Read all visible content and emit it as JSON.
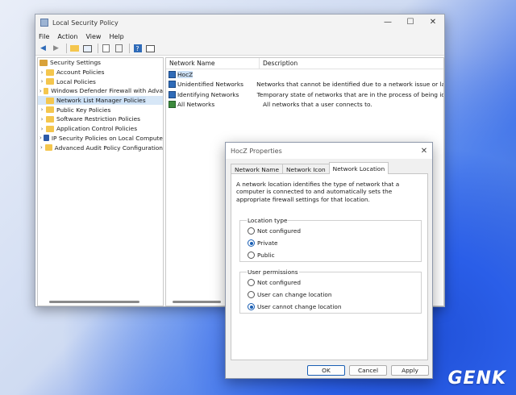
{
  "window": {
    "title": "Local Security Policy",
    "controls": {
      "minimize": "—",
      "maximize": "☐",
      "close": "✕"
    }
  },
  "menu": [
    "File",
    "Action",
    "View",
    "Help"
  ],
  "toolbar_icons": [
    "back-icon",
    "forward-icon",
    "up-folder-icon",
    "show-tree-icon",
    "properties-icon",
    "export-icon",
    "help-icon",
    "console-icon"
  ],
  "tree": {
    "root": "Security Settings",
    "items": [
      {
        "label": "Account Policies",
        "expandable": true,
        "icon": "folder-icon"
      },
      {
        "label": "Local Policies",
        "expandable": true,
        "icon": "folder-icon"
      },
      {
        "label": "Windows Defender Firewall with Adva",
        "expandable": true,
        "icon": "folder-icon"
      },
      {
        "label": "Network List Manager Policies",
        "expandable": false,
        "icon": "folder-icon",
        "selected": true
      },
      {
        "label": "Public Key Policies",
        "expandable": true,
        "icon": "folder-icon"
      },
      {
        "label": "Software Restriction Policies",
        "expandable": true,
        "icon": "folder-icon"
      },
      {
        "label": "Application Control Policies",
        "expandable": true,
        "icon": "folder-icon"
      },
      {
        "label": "IP Security Policies on Local Compute",
        "expandable": true,
        "icon": "shield-icon"
      },
      {
        "label": "Advanced Audit Policy Configuration",
        "expandable": true,
        "icon": "folder-icon"
      }
    ]
  },
  "list": {
    "columns": [
      "Network Name",
      "Description"
    ],
    "rows": [
      {
        "name": "HocZ",
        "description": "",
        "selected": true
      },
      {
        "name": "Unidentified Networks",
        "description": "Networks that cannot be identified due to a network issue or lack o"
      },
      {
        "name": "Identifying Networks",
        "description": "Temporary state of networks that are in the process of being identi"
      },
      {
        "name": "All Networks",
        "description": "All networks that a user connects to."
      }
    ]
  },
  "dialog": {
    "title": "HocZ Properties",
    "close": "✕",
    "tabs": [
      "Network Name",
      "Network Icon",
      "Network Location"
    ],
    "active_tab": "Network Location",
    "description": "A network location identifies the type of network that a computer is connected to and automatically sets the appropriate firewall settings for that location.",
    "location_type": {
      "label": "Location type",
      "options": [
        {
          "label": "Not configured",
          "selected": false
        },
        {
          "label": "Private",
          "selected": true
        },
        {
          "label": "Public",
          "selected": false
        }
      ]
    },
    "user_permissions": {
      "label": "User permissions",
      "options": [
        {
          "label": "Not configured",
          "selected": false
        },
        {
          "label": "User can change location",
          "selected": false
        },
        {
          "label": "User cannot change location",
          "selected": true
        }
      ]
    },
    "buttons": {
      "ok": "OK",
      "cancel": "Cancel",
      "apply": "Apply"
    }
  },
  "watermark": "GENK",
  "colors": {
    "accent": "#1a5fb4",
    "selection": "#cce0f5",
    "folder": "#f4c64e"
  }
}
